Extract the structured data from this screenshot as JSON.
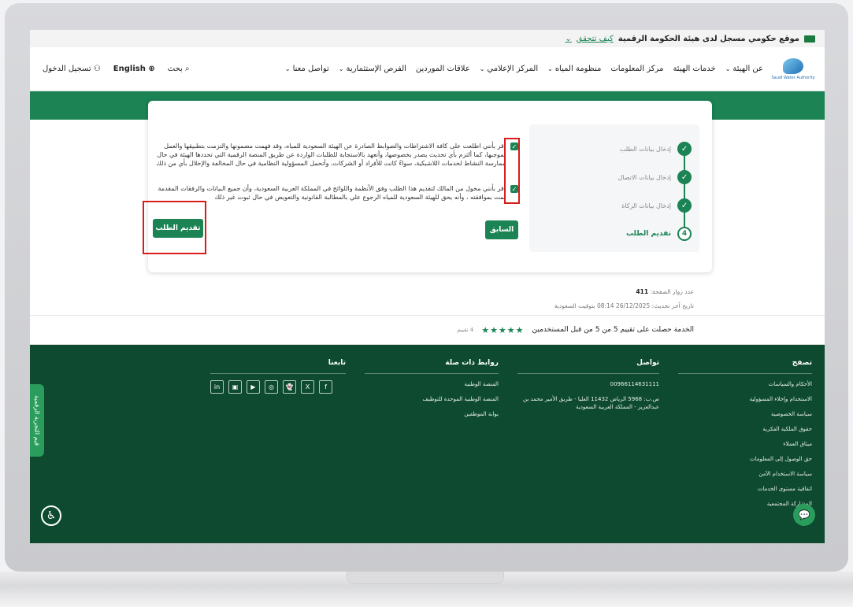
{
  "gov_bar": {
    "text": "موقع حكومي مسجل لدى هيئة الحكومة الرقمية",
    "verify": "كيف تتحقق"
  },
  "logo": {
    "text": "Saudi Water Authority"
  },
  "nav": {
    "items": [
      "عن الهيئة",
      "خدمات الهيئة",
      "مركز المعلومات",
      "منظومة المياه",
      "المركز الإعلامي",
      "علاقات الموردين",
      "الفرص الإستثمارية",
      "تواصل معنا"
    ],
    "search": "بحث",
    "language": "English",
    "login": "تسجيل الدخول"
  },
  "stepper": {
    "steps": [
      "إدخال بيانات الطلب",
      "إدخال بيانات الاتصال",
      "إدخال بيانات الزكاة",
      "تقديم الطلب"
    ],
    "active_number": "4"
  },
  "terms": {
    "t1": "أقر بأنني اطلعت على كافة الاشتراطات والضوابط الصادرة عن الهيئة السعودية للمياه، وقد فهمت مضمونها والتزمت بتطبيقها والعمل بموجبها، كما ألتزم بأي تحديث يصدر بخصوصها، وأتعهد بالاستجابة للطلبات الواردة عن طريق المنصة الرقمية التي تحددها الهيئة في حال ممارسة النشاط لخدمات اللاشبكية، سواءً كانت للأفراد أو الشركات، وأتحمل المسؤولية النظامية في حال المخالفة والإخلال بأي من ذلك",
    "t2": "أقر بأنني مخول من المالك لتقديم هذا الطلب وفق الأنظمة واللوائح في المملكة العربية السعودية، وأن جميع البيانات والرفقات المقدمة تمت بموافقته ، وأنه يحق للهيئة السعودية للمياه الرجوع علي بالمطالبة القانونية والتعويض في حال ثبوت غير ذلك"
  },
  "buttons": {
    "previous": "السابق",
    "submit": "تقديم الطلب"
  },
  "meta": {
    "visitors_label": "عدد زوار الصفحة:",
    "visitors": "411",
    "updated": "تاريخ آخر تحديث: 26/12/2025 08:14 بتوقيت السعودية"
  },
  "rating": {
    "text": "الخدمة حصلت على تقييم 5 من 5 من قبل المستخدمين",
    "stars": "★★★★★",
    "count": "4 تقييم"
  },
  "footer": {
    "browse": {
      "title": "تصفح",
      "items": [
        "الأحكام والسياسات",
        "الاستخدام وإخلاء المسؤولية",
        "سياسة الخصوصية",
        "حقوق الملكية الفكرية",
        "ميثاق العملاء",
        "حق الوصول إلى المعلومات",
        "سياسة الاستخدام الآمن",
        "اتفاقية مستوى الخدمات",
        "المشاركة المجتمعية"
      ]
    },
    "contact": {
      "title": "تواصل",
      "phone": "00966114631111",
      "address": "ص.ب: 5968 الرياض 11432 العليا - طريق الأمير محمد بن عبدالعزيز - المملكة العربية السعودية"
    },
    "links": {
      "title": "روابط ذات صلة",
      "items": [
        "المنصة الوطنية",
        "المنصة الوطنية الموحدة للتوظيف",
        "بوابة الموظفين"
      ]
    },
    "follow": {
      "title": "تابعنا",
      "icons": [
        "in",
        "▣",
        "▶",
        "◎",
        "👻",
        "X",
        "f"
      ]
    }
  },
  "side_tab": "قيم التجربة الرقمية"
}
